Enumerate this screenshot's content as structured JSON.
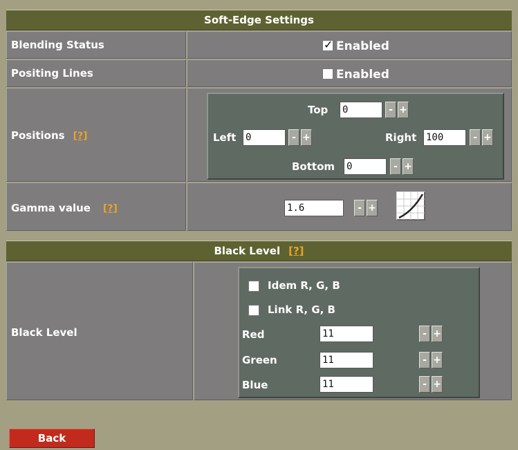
{
  "soft_edge": {
    "title": "Soft-Edge Settings",
    "blending_status": {
      "label": "Blending Status",
      "checkbox_label": "Enabled",
      "checked": true
    },
    "positing_lines": {
      "label": "Positing Lines",
      "checkbox_label": "Enabled",
      "checked": false
    },
    "positions": {
      "label": "Positions",
      "help": "[?]",
      "top": {
        "label": "Top",
        "value": "0"
      },
      "left": {
        "label": "Left",
        "value": "0"
      },
      "right": {
        "label": "Right",
        "value": "100"
      },
      "bottom": {
        "label": "Bottom",
        "value": "0"
      }
    },
    "gamma": {
      "label": "Gamma value",
      "help": "[?]",
      "value": "1.6",
      "curve_icon": "gamma-curve-icon"
    }
  },
  "black_level": {
    "title": "Black Level",
    "help": "[?]",
    "row_label": "Black Level",
    "idem_rgb": {
      "label": "Idem R, G, B",
      "checked": false
    },
    "link_rgb": {
      "label": "Link R, G, B",
      "checked": false
    },
    "red": {
      "label": "Red",
      "value": "11"
    },
    "green": {
      "label": "Green",
      "value": "11"
    },
    "blue": {
      "label": "Blue",
      "value": "11"
    }
  },
  "stepper": {
    "minus": "-",
    "plus": "+"
  },
  "back_label": "Back",
  "colors": {
    "header": "#5e6232",
    "cell": "#7e7c7c",
    "panel": "#5f6a62",
    "background": "#a39f83",
    "help": "#e9a327",
    "back_button": "#c22a1e"
  }
}
